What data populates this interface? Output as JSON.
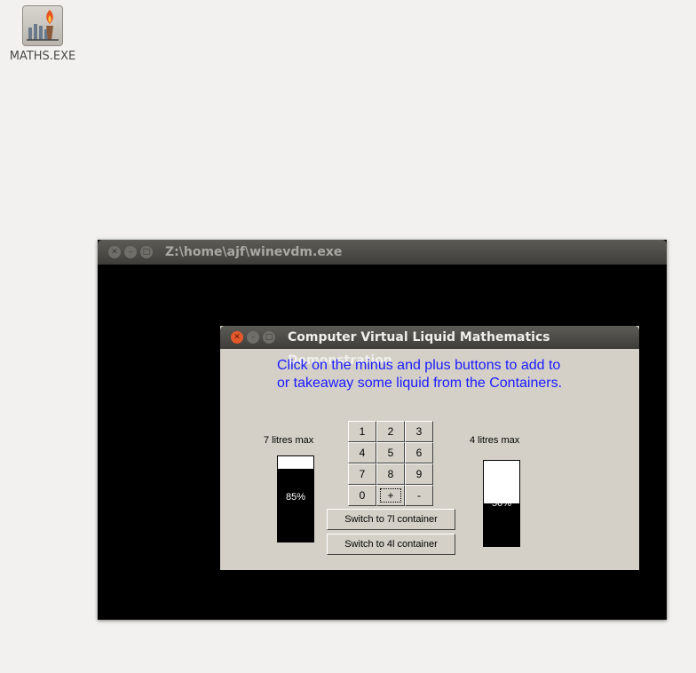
{
  "desktop": {
    "icon": {
      "name": "torch-icon",
      "label": "MATHS.EXE"
    }
  },
  "outer_window": {
    "title": "Z:\\home\\ajf\\winevdm.exe"
  },
  "app_window": {
    "title": "Computer Virtual Liquid Mathematics Demonstration",
    "instruction_line1": "Click on the minus and plus buttons to add to",
    "instruction_line2": "or takeaway some liquid from the Containers.",
    "left_container": {
      "label": "7 litres max",
      "percent_text": "85%",
      "fill_fraction": 0.85
    },
    "right_container": {
      "label": "4 litres max",
      "percent_text": "50%",
      "fill_fraction": 0.5
    },
    "keypad": [
      "1",
      "2",
      "3",
      "4",
      "5",
      "6",
      "7",
      "8",
      "9",
      "0",
      "+",
      "-"
    ],
    "switch_7l": "Switch to 7l container",
    "switch_4l": "Switch to 4l container"
  },
  "colors": {
    "instruction_text": "#1a1aff",
    "dialog_face": "#d4d0c8",
    "titlebar": "#3e3d39",
    "close_button": "#e4582c"
  }
}
